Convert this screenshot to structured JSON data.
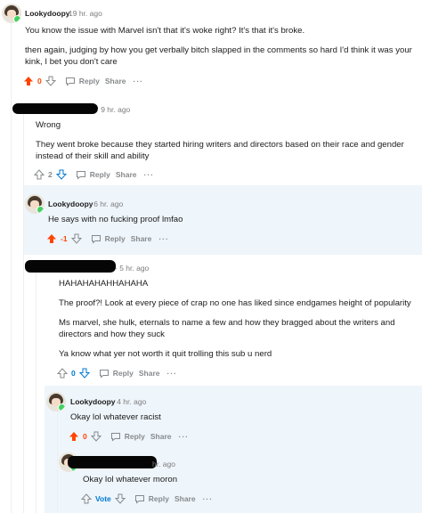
{
  "comments": [
    {
      "username": "Lookydoopy",
      "time": "19 hr. ago",
      "paragraphs": [
        "You know the issue with Marvel isn't that it's woke right? It's that it's broke.",
        "then again, judging by how you get verbally bitch slapped in the comments so hard I'd think it was your kink, I bet you don't care"
      ],
      "score": "0",
      "vote_state": "up",
      "reply_label": "Reply",
      "share_label": "Share",
      "more_label": "···"
    },
    {
      "username": "",
      "time": "· 9 hr. ago",
      "paragraphs": [
        "Wrong",
        "They went broke because they started hiring writers and directors based on their race and gender instead of their skill and ability"
      ],
      "score": "2",
      "vote_state": "none",
      "reply_label": "Reply",
      "share_label": "Share",
      "more_label": "···"
    },
    {
      "username": "Lookydoopy",
      "time": "· 6 hr. ago",
      "paragraphs": [
        "He says with no fucking proof lmfao"
      ],
      "score": "-1",
      "vote_state": "up",
      "reply_label": "Reply",
      "share_label": "Share",
      "more_label": "···"
    },
    {
      "username": "",
      "time": "· 5 hr. ago",
      "paragraphs": [
        "HAHAHAHAHHAHAHA",
        "The proof?! Look at every piece of crap no one has liked since endgames height of popularity",
        "Ms marvel, she hulk, eternals to name a few and how they bragged about the writers and directors and how they suck",
        "Ya know what yer not worth it quit trolling this sub u nerd"
      ],
      "score": "0",
      "vote_state": "none",
      "reply_label": "Reply",
      "share_label": "Share",
      "more_label": "···"
    },
    {
      "username": "Lookydoopy",
      "time": "· 4 hr. ago",
      "paragraphs": [
        "Okay lol whatever racist"
      ],
      "score": "0",
      "vote_state": "up",
      "reply_label": "Reply",
      "share_label": "Share",
      "more_label": "···"
    },
    {
      "username": "",
      "time": "hr. ago",
      "paragraphs": [
        "Okay lol whatever moron"
      ],
      "score": "Vote",
      "vote_state": "none",
      "reply_label": "Reply",
      "share_label": "Share",
      "more_label": "···"
    }
  ],
  "colors": {
    "upvote_active": "#ff4500",
    "vote_idle": "#878a8c",
    "vote_count_blue": "#0079d3",
    "online_dot": "#46d160",
    "highlight_bg": "#eef5fb"
  },
  "icons": {
    "upvote": "arrow-up-icon",
    "downvote": "arrow-down-icon",
    "reply": "speech-bubble-icon",
    "avatar": "snoo-avatar-icon"
  }
}
